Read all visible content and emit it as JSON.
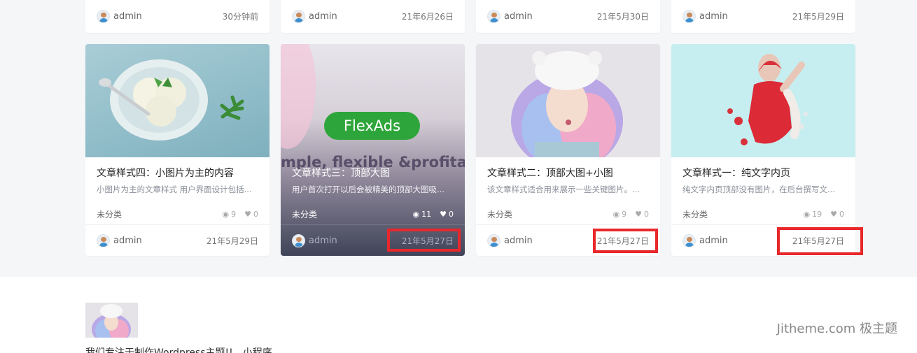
{
  "top_row": [
    {
      "author": "admin",
      "date": "30分钟前"
    },
    {
      "author": "admin",
      "date": "21年6月26日"
    },
    {
      "author": "admin",
      "date": "21年5月30日"
    },
    {
      "author": "admin",
      "date": "21年5月29日"
    }
  ],
  "cards": [
    {
      "title": "文章样式四：小图片为主的内容",
      "excerpt": "小图片为主的文章样式 用户界面设计包括...",
      "category": "未分类",
      "views": "9",
      "likes": "0",
      "author": "admin",
      "date": "21年5月29日"
    },
    {
      "title": "文章样式三：顶部大图",
      "excerpt": "用户首次打开以后会被精美的顶部大图吸...",
      "category": "未分类",
      "views": "11",
      "likes": "0",
      "author": "admin",
      "date": "21年5月27日",
      "banner_text": "FlexAds",
      "banner_tagline": "mple, flexible &profita"
    },
    {
      "title": "文章样式二：顶部大图+小图",
      "excerpt": "该文章样式适合用来展示一些关键图片。...",
      "category": "未分类",
      "views": "9",
      "likes": "0",
      "author": "admin",
      "date": "21年5月27日"
    },
    {
      "title": "文章样式一：纯文字内页",
      "excerpt": "纯文字内页顶部没有图片，在后台撰写文...",
      "category": "未分类",
      "views": "19",
      "likes": "0",
      "author": "admin",
      "date": "21年5月27日"
    }
  ],
  "footer": {
    "text": "我们专注于制作Wordpress主题!!、小程序"
  },
  "watermark": "Jitheme.com 极主题",
  "colors": {
    "highlight": "#e8282b",
    "flexads_green": "#2ea53a"
  }
}
